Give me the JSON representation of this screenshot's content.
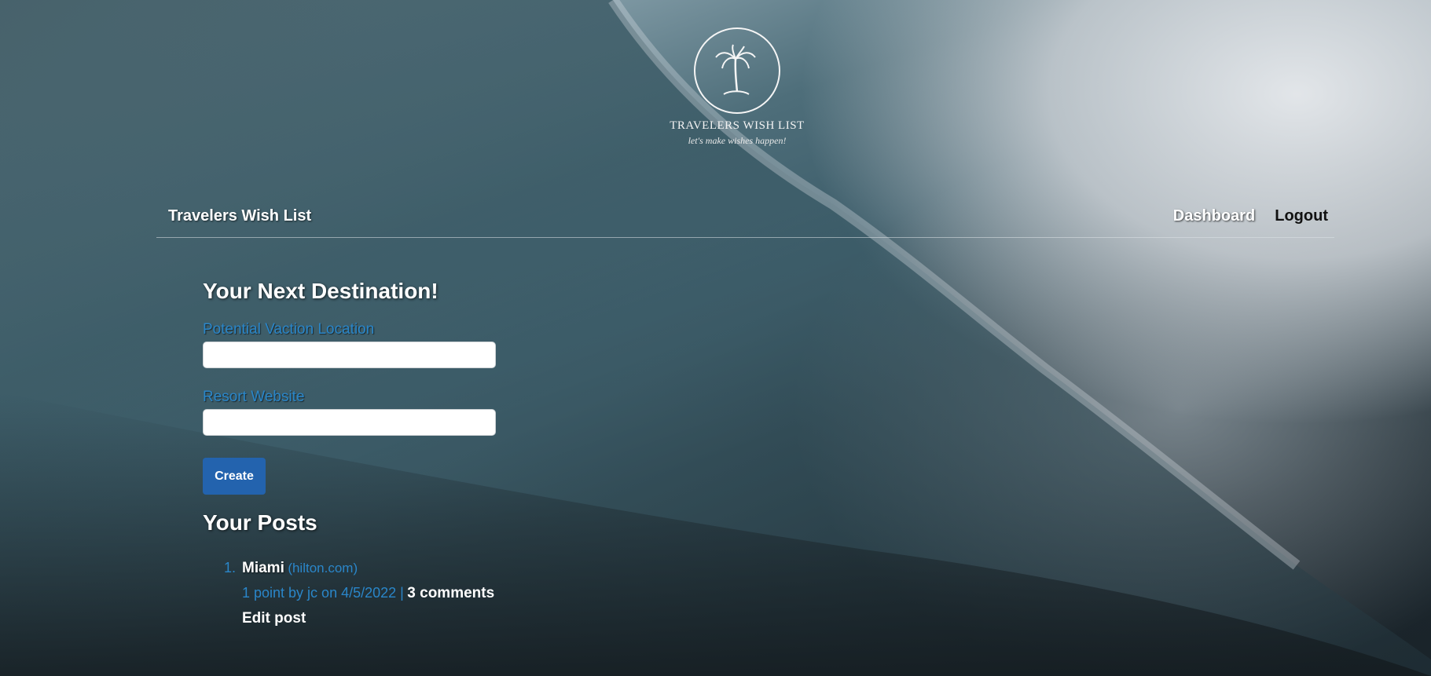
{
  "logo": {
    "title": "TRAVELERS WISH LIST",
    "tagline": "let's make wishes happen!",
    "icon": "palm-tree-icon"
  },
  "navbar": {
    "brand": "Travelers Wish List",
    "links": {
      "dashboard": "Dashboard",
      "logout": "Logout"
    }
  },
  "form": {
    "heading": "Your Next Destination!",
    "location_label": "Potential Vaction Location",
    "location_value": "",
    "website_label": "Resort Website",
    "website_value": "",
    "submit_label": "Create"
  },
  "posts": {
    "heading": "Your Posts",
    "items": [
      {
        "number": "1.",
        "title": "Miami",
        "domain": "(hilton.com)",
        "meta": "1 point by jc on 4/5/2022 |",
        "comments": "3 comments",
        "edit": "Edit post"
      }
    ]
  },
  "colors": {
    "link_blue": "#2a86c9",
    "button_blue": "#2363ae",
    "text_white": "#ffffff"
  }
}
